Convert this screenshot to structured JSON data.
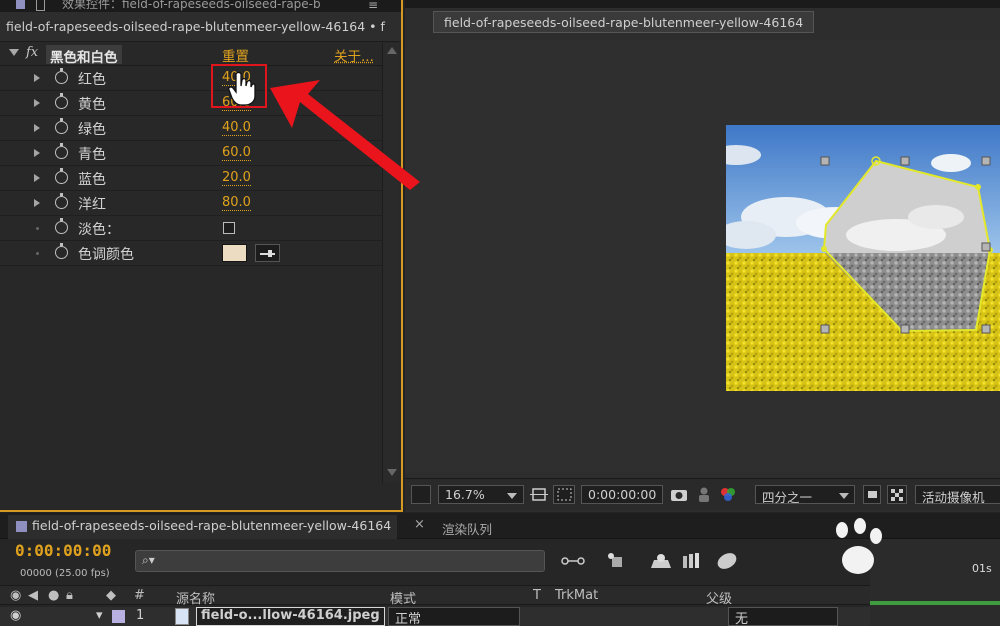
{
  "effect_panel": {
    "tab_title": "效果控件：field-of-rapeseeds-oilseed-rape-b",
    "tab_menu_icon": "menu-icon",
    "layer_line": "field-of-rapeseeds-oilseed-rape-blutenmeer-yellow-46164 • f",
    "effect": {
      "fx_label": "fx",
      "name": "黑色和白色",
      "reset": "重置",
      "about": "关于..."
    },
    "properties": [
      {
        "label": "红色",
        "value": "40.0",
        "kind": "value"
      },
      {
        "label": "黄色",
        "value": "60.0",
        "kind": "value"
      },
      {
        "label": "绿色",
        "value": "40.0",
        "kind": "value"
      },
      {
        "label": "青色",
        "value": "60.0",
        "kind": "value"
      },
      {
        "label": "蓝色",
        "value": "20.0",
        "kind": "value"
      },
      {
        "label": "洋红",
        "value": "80.0",
        "kind": "value"
      },
      {
        "label": "淡色：",
        "value": "",
        "kind": "checkbox"
      },
      {
        "label": "色调颜色",
        "value": "",
        "kind": "color",
        "color": "#ecdcc1"
      }
    ]
  },
  "viewer": {
    "comp_tab": "field-of-rapeseeds-oilseed-rape-blutenmeer-yellow-46164",
    "toolbar": {
      "zoom": "16.7%",
      "timecode": "0:00:00:00",
      "resolution": "四分之一",
      "camera": "活动摄像机"
    }
  },
  "timeline": {
    "comp_tab": "field-of-rapeseeds-oilseed-rape-blutenmeer-yellow-46164",
    "close_glyph": "×",
    "render_queue_tab": "渲染队列",
    "current_time": "0:00:00:00",
    "fps": "00000 (25.00 fps)",
    "search_placeholder": "⌕▾",
    "columns": {
      "number": "#",
      "source_name": "源名称",
      "mode": "模式",
      "t": "T",
      "trkmat": "TrkMat",
      "parent": "父级"
    },
    "layer": {
      "number": "1",
      "name": "field-o...llow-46164.jpeg",
      "mode": "正常",
      "parent": "无"
    },
    "ruler_label": "01s"
  },
  "colors": {
    "accent": "#e0a21e",
    "annotation_red": "#e0141c",
    "tint": "#ecdcc1",
    "selection_outline": "#d59a1f"
  }
}
